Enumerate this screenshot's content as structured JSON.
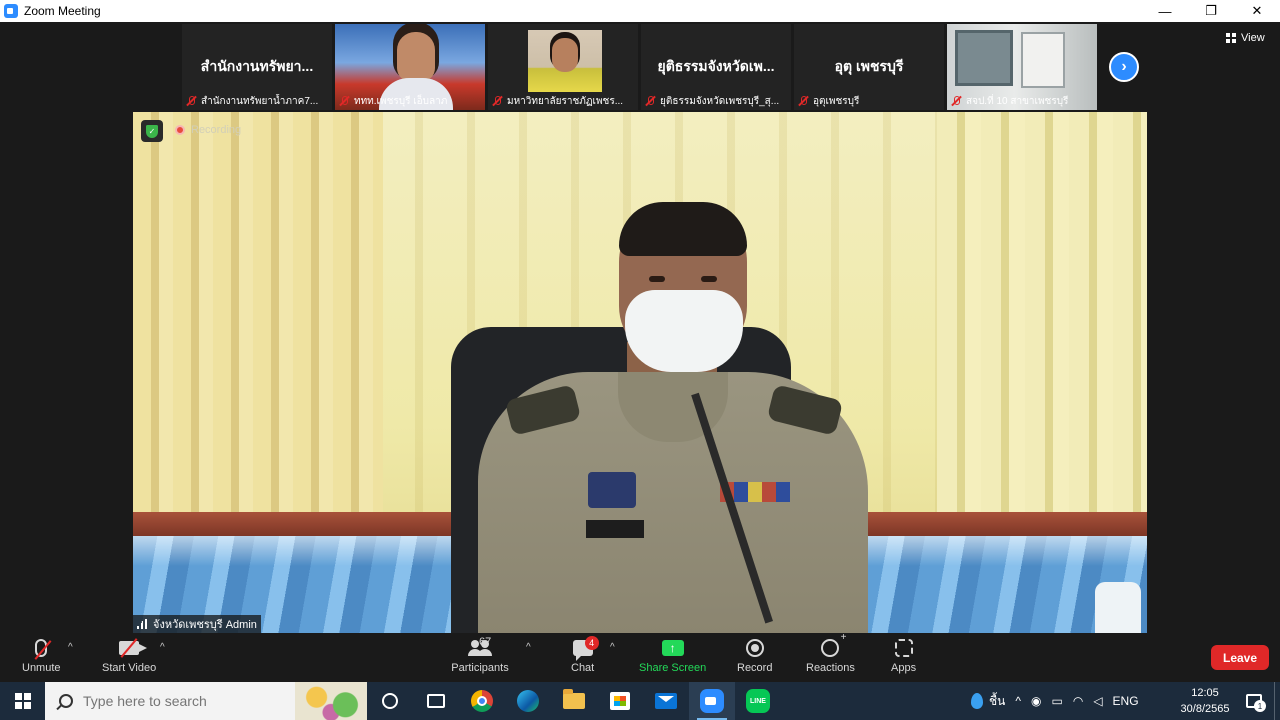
{
  "window": {
    "title": "Zoom Meeting",
    "controls": {
      "minimize": "—",
      "restore": "❐",
      "close": "✕"
    }
  },
  "strip": {
    "tiles": [
      {
        "kind": "name",
        "display_name": "สำนักงานทรัพยา...",
        "label": "สำนักงานทรัพยาน้ำภาค7..."
      },
      {
        "kind": "video",
        "label": "ททท.เพชรบุรี เอ็บลาภ"
      },
      {
        "kind": "video",
        "label": "มหาวิทยาลัยราชภัฏเพชร..."
      },
      {
        "kind": "name",
        "display_name": "ยุติธรรมจังหวัดเพ...",
        "label": "ยุติธรรมจังหวัดเพชรบุรี_สุ..."
      },
      {
        "kind": "name",
        "display_name": "อุตุ เพชรบุรี",
        "label": "อุตุเพชรบุรี"
      },
      {
        "kind": "video",
        "label": "สจป.ที่ 10 สาขาเพชรบุรี"
      }
    ],
    "next_icon": "›",
    "view_label": "View"
  },
  "main_video": {
    "recording_label": "Recording",
    "speaker_name": "จังหวัดเพชรบุรี Admin"
  },
  "toolbar": {
    "unmute_label": "Unmute",
    "start_video_label": "Start Video",
    "participants_label": "Participants",
    "participants_count": "67",
    "chat_label": "Chat",
    "chat_badge": "4",
    "share_label": "Share Screen",
    "share_icon": "↑",
    "record_label": "Record",
    "reactions_label": "Reactions",
    "apps_label": "Apps",
    "leave_label": "Leave",
    "caret": "^",
    "colors": {
      "share": "#23d959",
      "leave": "#e02828",
      "accent": "#2d8cff"
    }
  },
  "taskbar": {
    "search_placeholder": "Type here to search",
    "line_label": "LINE",
    "tray": {
      "weather": "ชื้น",
      "caret": "^",
      "lang": "ENG",
      "time": "12:05",
      "date": "30/8/2565",
      "notifications": "1"
    }
  }
}
